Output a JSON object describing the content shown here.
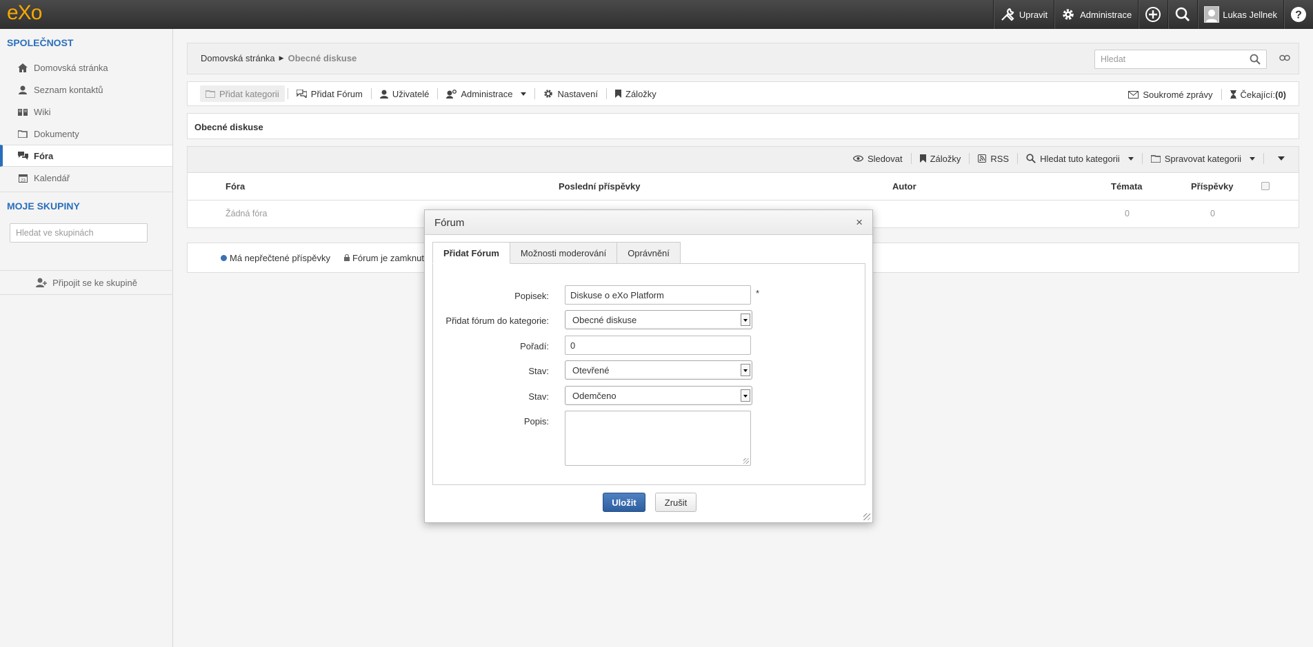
{
  "topbar": {
    "logo": "eXo",
    "edit_label": "Upravit",
    "admin_label": "Administrace",
    "user_name": "Lukas Jellnek"
  },
  "sidebar": {
    "company_heading": "SPOLEČNOST",
    "items": [
      {
        "label": "Domovská stránka",
        "icon": "home-icon"
      },
      {
        "label": "Seznam kontaktů",
        "icon": "user-icon"
      },
      {
        "label": "Wiki",
        "icon": "book-icon"
      },
      {
        "label": "Dokumenty",
        "icon": "folder-icon"
      },
      {
        "label": "Fóra",
        "icon": "chat-icon",
        "active": true
      },
      {
        "label": "Kalendář",
        "icon": "calendar-icon"
      }
    ],
    "groups_heading": "MOJE SKUPINY",
    "group_search_placeholder": "Hledat ve skupinách",
    "join_group_label": "Připojit se ke skupině"
  },
  "breadcrumb": {
    "home": "Domovská stránka",
    "current": "Obecné diskuse",
    "search_placeholder": "Hledat"
  },
  "toolbar": {
    "add_category": "Přidat kategorii",
    "add_forum": "Přidat Fórum",
    "users": "Uživatelé",
    "administration": "Administrace",
    "settings": "Nastavení",
    "bookmarks": "Záložky",
    "private_messages": "Soukromé zprávy",
    "pending_label": "Čekající:",
    "pending_count": "(0)"
  },
  "category": {
    "title": "Obecné diskuse",
    "actions": {
      "watch": "Sledovat",
      "bookmarks": "Záložky",
      "rss": "RSS",
      "search_category": "Hledat tuto kategorii",
      "manage_category": "Spravovat kategorii"
    },
    "columns": {
      "forums": "Fóra",
      "last_posts": "Poslední příspěvky",
      "author": "Autor",
      "topics": "Témata",
      "posts": "Příspěvky"
    },
    "empty_row": {
      "label": "Žádná fóra",
      "topics": "0",
      "posts": "0"
    }
  },
  "legend": {
    "unread": "Má nepřečtené příspěvky",
    "locked": "Fórum je zamknuto"
  },
  "dialog": {
    "title": "Fórum",
    "tabs": [
      "Přidat Fórum",
      "Možnosti moderování",
      "Oprávnění"
    ],
    "fields": {
      "label_label": "Popisek:",
      "label_value": "Diskuse o eXo Platform",
      "category_label": "Přidat fórum do kategorie:",
      "category_value": "Obecné diskuse",
      "order_label": "Pořadí:",
      "order_value": "0",
      "status1_label": "Stav:",
      "status1_value": "Otevřené",
      "status2_label": "Stav:",
      "status2_value": "Odemčeno",
      "description_label": "Popis:",
      "description_value": ""
    },
    "required_mark": "*",
    "save_label": "Uložit",
    "cancel_label": "Zrušit"
  },
  "colors": {
    "accent": "#2a6ebb",
    "logo": "#f7a800",
    "primary_button": "#3a6eb0",
    "topbar": "#3a3a3a"
  }
}
